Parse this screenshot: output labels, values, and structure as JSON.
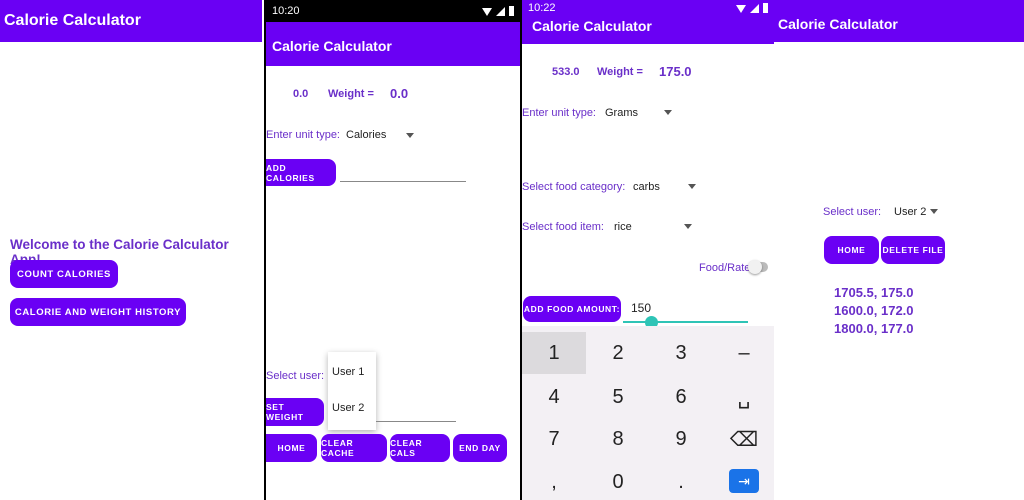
{
  "p1": {
    "title": "Calorie Calculator",
    "welcome": "Welcome to the Calorie Calculator App!",
    "count_btn": "COUNT CALORIES",
    "history_btn": "CALORIE AND WEIGHT HISTORY"
  },
  "p2": {
    "time": "10:20",
    "title": "Calorie Calculator",
    "calories": "0.0",
    "weight_label": "Weight =",
    "weight": "0.0",
    "unit_label": "Enter unit type:",
    "unit_value": "Calories",
    "add_btn": "ADD CALORIES",
    "user_label": "Select user:",
    "dropdown": [
      "User 1",
      "User 2"
    ],
    "set_weight_btn": "SET WEIGHT",
    "home_btn": "HOME",
    "clear_cache_btn": "CLEAR CACHE",
    "clear_cals_btn": "CLEAR CALS",
    "end_day_btn": "END DAY"
  },
  "p3": {
    "time": "10:22",
    "title": "Calorie Calculator",
    "calories": "533.0",
    "weight_label": "Weight =",
    "weight": "175.0",
    "unit_label": "Enter unit type:",
    "unit_value": "Grams",
    "category_label": "Select food category:",
    "category_value": "carbs",
    "item_label": "Select food item:",
    "item_value": "rice",
    "toggle_label": "Food/Rate",
    "toggle_on": false,
    "add_btn": "ADD FOOD AMOUNT:",
    "amount": "150",
    "slider_fraction": 0.22,
    "keys": [
      "1",
      "2",
      "3",
      "–",
      "4",
      "5",
      "6",
      "␣",
      "7",
      "8",
      "9",
      "⌫",
      ",",
      "0",
      ".",
      "⇥"
    ]
  },
  "p4": {
    "title": "Calorie Calculator",
    "user_label": "Select user:",
    "user_value": "User 2",
    "home_btn": "HOME",
    "delete_btn": "DELETE FILE",
    "history": [
      "1705.5, 175.0",
      "1600.0, 172.0",
      "1800.0, 177.0"
    ]
  },
  "colors": {
    "primary": "#6a00f4",
    "accent_text": "#6a2fc9",
    "slider": "#2ec4b6"
  }
}
